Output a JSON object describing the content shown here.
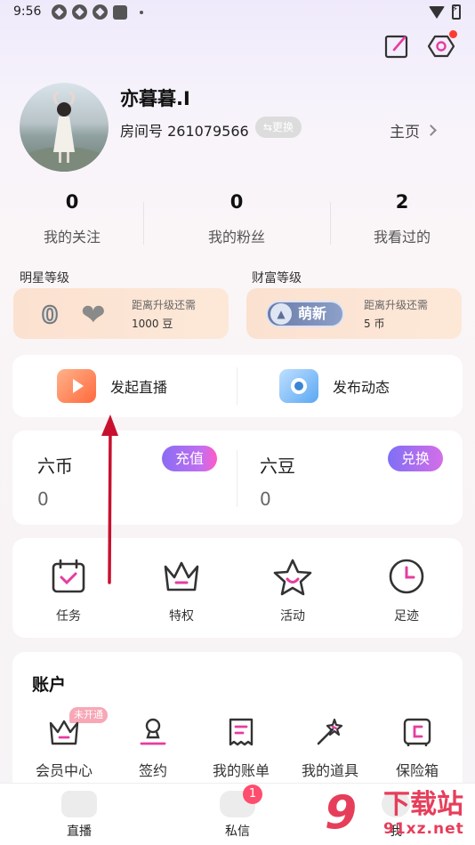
{
  "status_bar": {
    "time": "9:56"
  },
  "profile": {
    "name": "亦暮暮.I",
    "room_label": "房间号 261079566",
    "switch_label": "⇆更换",
    "home_label": "主页"
  },
  "stats": [
    {
      "value": "0",
      "label": "我的关注"
    },
    {
      "value": "0",
      "label": "我的粉丝"
    },
    {
      "value": "2",
      "label": "我看过的"
    }
  ],
  "levels": {
    "star": {
      "title": "明星等级",
      "level_glyph": "0",
      "sub": "距离升级还需",
      "value": "1000 豆"
    },
    "wealth": {
      "title": "财富等级",
      "badge": "萌新",
      "sub": "距离升级还需",
      "value": "5 币"
    }
  },
  "actions": {
    "live": "发起直播",
    "post": "发布动态"
  },
  "currency": {
    "liu_coin": {
      "name": "六币",
      "value": "0",
      "button": "充值"
    },
    "liu_bean": {
      "name": "六豆",
      "value": "0",
      "button": "兑换"
    }
  },
  "features": [
    {
      "label": "任务",
      "icon": "calendar-check-icon"
    },
    {
      "label": "特权",
      "icon": "crown-icon"
    },
    {
      "label": "活动",
      "icon": "star-icon"
    },
    {
      "label": "足迹",
      "icon": "clock-icon"
    }
  ],
  "account": {
    "title": "账户",
    "not_open_badge": "未开通",
    "items": [
      {
        "label": "会员中心",
        "icon": "crown-icon"
      },
      {
        "label": "签约",
        "icon": "stamp-icon"
      },
      {
        "label": "我的账单",
        "icon": "bill-icon"
      },
      {
        "label": "我的道具",
        "icon": "magic-wand-icon"
      },
      {
        "label": "保险箱",
        "icon": "safe-icon"
      }
    ]
  },
  "bottom_nav": {
    "items": [
      {
        "label": "直播"
      },
      {
        "label": "私信"
      },
      {
        "label": "我"
      }
    ],
    "message_badge": "1"
  },
  "watermark": {
    "logo": "9",
    "text": "下载站",
    "url": "91xz.net"
  },
  "colors": {
    "accent_purple": "#8a6cf3",
    "badge_red": "#ff4d6d",
    "arrow_red": "#c8102e"
  }
}
